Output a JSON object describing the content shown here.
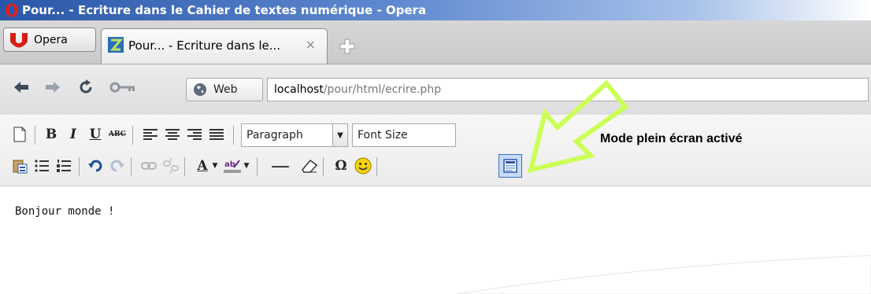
{
  "window": {
    "title": "Pour... - Ecriture dans le Cahier de textes numérique - Opera"
  },
  "tabs": {
    "menu_label": "Opera",
    "active_tab_label": "Pour... - Ecriture dans le...",
    "close_glyph": "×"
  },
  "address": {
    "web_label": "Web",
    "url_host": "localhost",
    "url_path": "/pour/html/ecrire.php"
  },
  "toolbar": {
    "format_select": "Paragraph",
    "font_size_select": "Font Size",
    "bold": "B",
    "italic": "I",
    "underline": "U",
    "strike": "ABC",
    "omega": "Ω",
    "text_color": "A",
    "hr": "—"
  },
  "annotation": {
    "text": "Mode plein écran activé"
  },
  "editor": {
    "content": "Bonjour monde !"
  },
  "colors": {
    "arrow": "#ccff55",
    "title_gradient_start": "#2a56a8",
    "fullscreen_active": "#c6dcf6"
  }
}
